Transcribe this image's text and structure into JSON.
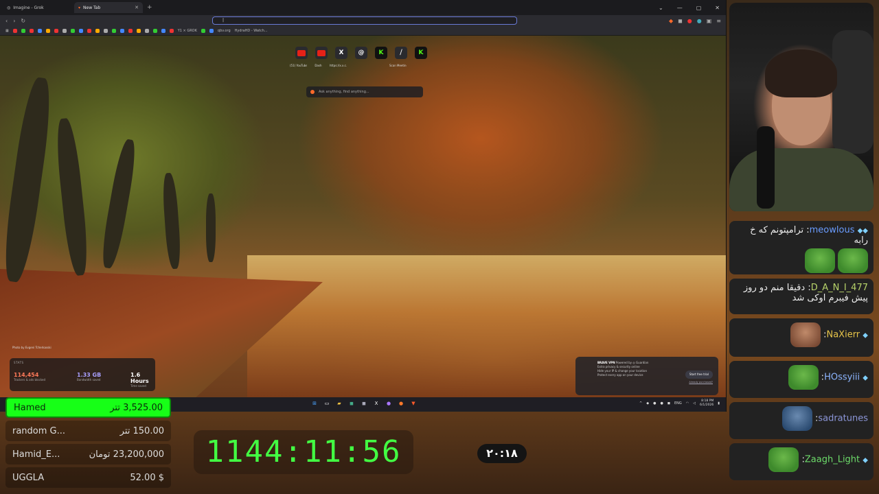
{
  "browser": {
    "tabs": [
      {
        "title": "Imagine - Grok",
        "active": false
      },
      {
        "title": "New Tab",
        "active": true
      }
    ],
    "bookmarks": [
      "Y1 × GROK",
      "qbv.org",
      "HydraHD - Watch..."
    ],
    "shortcuts": [
      {
        "icon": "youtube-icon",
        "label": "(51) YouTube",
        "color": "#e62117"
      },
      {
        "icon": "youtube-icon",
        "label": "Dash",
        "color": "#e62117"
      },
      {
        "icon": "x-icon",
        "label": "https://x.x.c...",
        "color": "#000000"
      },
      {
        "icon": "threads-icon",
        "label": "",
        "color": "#000000"
      },
      {
        "icon": "kick-icon",
        "label": "",
        "color": "#53fc18"
      },
      {
        "icon": "grok-icon",
        "label": "Scan Meeting",
        "color": "#000000"
      },
      {
        "icon": "kick-icon",
        "label": "",
        "color": "#53fc18"
      }
    ],
    "ask_placeholder": "Ask anything, find anything...",
    "photo_credit": "Photo by Evgeni Tcherkasski",
    "stats": {
      "label": "STATS",
      "trackers_value": "114,454",
      "trackers_label": "Trackers & ads blocked",
      "bandwidth_value": "1.33 GB",
      "bandwidth_label": "Bandwidth saved",
      "time_value": "1.6 Hours",
      "time_label": "Time saved"
    },
    "vpn": {
      "title": "BRAVE VPN",
      "powered": "Powered by ◎ Guardian",
      "lines": [
        "Extra privacy & security online",
        "Hide your IP & change your location",
        "Protect every app on your device"
      ],
      "button": "Start free trial",
      "link": "Already purchased?"
    },
    "taskbar": {
      "lang": "ENG",
      "time": "8:18 PM",
      "date": "6/1/2026"
    }
  },
  "chat": [
    {
      "user": "meowlous",
      "text": "ترامپتونم که خ رابه",
      "emote": "pepe"
    },
    {
      "user": "D_A_N_I_477",
      "text": "دقیقا منم دو روز پیش فیبرم اوکی شد",
      "emote": ""
    },
    {
      "user": "NaXierr",
      "text": "",
      "emote": "face2"
    },
    {
      "user": "HOssyiii",
      "text": "",
      "emote": "pepe"
    },
    {
      "user": "sadratunes",
      "text": "",
      "emote": "face3"
    },
    {
      "user": "Zaagh_Light",
      "text": "",
      "emote": "pepe"
    }
  ],
  "leaderboard": [
    {
      "name": "Hamed",
      "amount": "3,525.00 تتر"
    },
    {
      "name": "random G...",
      "amount": "150.00 تتر"
    },
    {
      "name": "Hamid_E...",
      "amount": "23,200,000 تومان"
    },
    {
      "name": "UGGLA",
      "amount": "$ 52.00"
    }
  ],
  "timer": "1144:11:56",
  "clock": "۲۰:۱۸"
}
